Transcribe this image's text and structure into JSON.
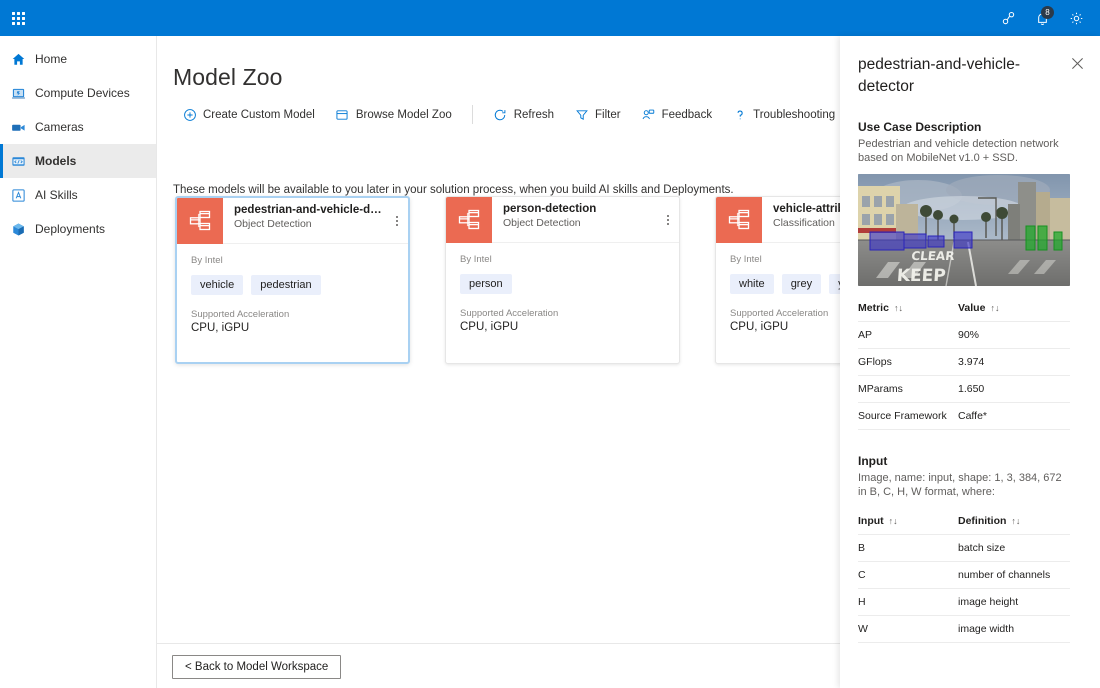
{
  "topbar": {
    "waffle_icon": "app-launcher-icon",
    "icons": [
      {
        "name": "share-connect-icon",
        "label": "Share"
      },
      {
        "name": "notifications-bell-icon",
        "label": "Notifications",
        "badge": "8"
      },
      {
        "name": "settings-gear-icon",
        "label": "Settings"
      }
    ],
    "accent_color": "#0078d4"
  },
  "sidebar": {
    "items": [
      {
        "label": "Home",
        "icon": "home-icon",
        "selected": false
      },
      {
        "label": "Compute Devices",
        "icon": "laptop-icon",
        "selected": false
      },
      {
        "label": "Cameras",
        "icon": "camera-icon",
        "selected": false
      },
      {
        "label": "Models",
        "icon": "models-code-icon",
        "selected": true
      },
      {
        "label": "AI Skills",
        "icon": "ai-skills-icon",
        "selected": false
      },
      {
        "label": "Deployments",
        "icon": "deployments-cube-icon",
        "selected": false
      }
    ]
  },
  "main": {
    "title": "Model Zoo",
    "toolbar": [
      {
        "label": "Create Custom Model",
        "icon": "plus-circle-icon"
      },
      {
        "label": "Browse Model Zoo",
        "icon": "browse-icon"
      },
      {
        "separator": true
      },
      {
        "label": "Refresh",
        "icon": "refresh-icon"
      },
      {
        "label": "Filter",
        "icon": "filter-funnel-icon"
      },
      {
        "label": "Feedback",
        "icon": "feedback-person-icon"
      },
      {
        "label": "Troubleshooting",
        "icon": "question-mark-icon"
      }
    ],
    "subtitle": "These models will be available to you later in your solution process, when you build AI skills and Deployments.",
    "cards": [
      {
        "name": "pedestrian-and-vehicle-det...",
        "type": "Object Detection",
        "author_label": "By Intel",
        "tags": [
          "vehicle",
          "pedestrian"
        ],
        "accel_label": "Supported Acceleration",
        "accel": "CPU, iGPU",
        "selected": true,
        "thumb_icon": "model-graph-icon",
        "thumb_color": "#eb6a52"
      },
      {
        "name": "person-detection",
        "type": "Object Detection",
        "author_label": "By Intel",
        "tags": [
          "person"
        ],
        "accel_label": "Supported Acceleration",
        "accel": "CPU, iGPU",
        "selected": false,
        "thumb_icon": "model-graph-icon",
        "thumb_color": "#eb6a52"
      },
      {
        "name": "vehicle-attributes",
        "type": "Classification",
        "author_label": "By Intel",
        "tags": [
          "white",
          "grey",
          "yellow"
        ],
        "accel_label": "Supported Acceleration",
        "accel": "CPU, iGPU",
        "selected": false,
        "thumb_icon": "model-graph-icon",
        "thumb_color": "#eb6a52"
      }
    ],
    "back_button": "< Back to Model Workspace"
  },
  "panel": {
    "title": "pedestrian-and-vehicle-detector",
    "close_icon": "close-icon",
    "usecase_heading": "Use Case Description",
    "usecase_text": "Pedestrian and vehicle detection network based on MobileNet v1.0 + SSD.",
    "preview_alt": "street scene with detected vehicles and pedestrians",
    "metrics_table": {
      "headers": [
        "Metric",
        "Value"
      ],
      "sort_icon": "↑↓",
      "rows": [
        [
          "AP",
          "90%"
        ],
        [
          "GFlops",
          "3.974"
        ],
        [
          "MParams",
          "1.650"
        ],
        [
          "Source Framework",
          "Caffe*"
        ]
      ]
    },
    "input_heading": "Input",
    "input_text": "Image, name: input, shape: 1, 3, 384, 672 in B, C, H, W format, where:",
    "input_table": {
      "headers": [
        "Input",
        "Definition"
      ],
      "sort_icon": "↑↓",
      "rows": [
        [
          "B",
          "batch size"
        ],
        [
          "C",
          "number of channels"
        ],
        [
          "H",
          "image height"
        ],
        [
          "W",
          "image width"
        ]
      ]
    }
  }
}
